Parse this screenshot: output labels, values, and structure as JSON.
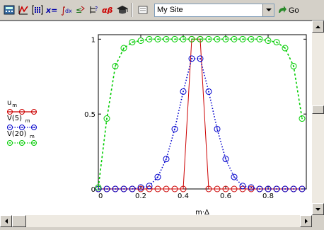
{
  "toolbar": {
    "address_value": "My Site",
    "go_label": "Go",
    "icons": [
      "calculator-icon",
      "graph-icon",
      "matrix-icon",
      "evaluation-icon",
      "calculus-icon",
      "boolean-icon",
      "programming-icon",
      "greek-icon",
      "symbolic-icon"
    ]
  },
  "legend": {
    "items": [
      {
        "label": "u",
        "sub": "m",
        "color": "#cc0000",
        "marker": "circle"
      },
      {
        "label": "V(5)",
        "sub": "m",
        "color": "#0000cc",
        "marker": "circle-dot"
      },
      {
        "label": "V(20)",
        "sub": "m",
        "color": "#00cc00",
        "marker": "circle-dot"
      }
    ]
  },
  "chart_data": {
    "type": "line",
    "xlabel": "m·Δ",
    "ylabel": "",
    "xlim": [
      0,
      0.98
    ],
    "ylim": [
      0,
      1.03
    ],
    "xticks": [
      0,
      0.2,
      0.4,
      0.6,
      0.8
    ],
    "xtick_labels": [
      "0",
      "0.2",
      "0.4",
      "0.6",
      "0.8"
    ],
    "yticks": [
      0,
      0.5,
      1
    ],
    "ytick_labels": [
      "0",
      "0.5",
      "1"
    ],
    "x": [
      0,
      0.04,
      0.08,
      0.12,
      0.16,
      0.2,
      0.24,
      0.28,
      0.32,
      0.36,
      0.4,
      0.44,
      0.48,
      0.52,
      0.56,
      0.6,
      0.64,
      0.68,
      0.72,
      0.76,
      0.8,
      0.84,
      0.88,
      0.92,
      0.96
    ],
    "series": [
      {
        "name": "u_m",
        "color": "#cc0000",
        "style": "solid",
        "values": [
          0,
          0,
          0,
          0,
          0,
          0,
          0,
          0,
          0,
          0,
          0,
          1,
          1,
          0,
          0,
          0,
          0,
          0,
          0,
          0,
          0,
          0,
          0,
          0,
          0
        ]
      },
      {
        "name": "V(5)_m",
        "color": "#0000cc",
        "style": "dotted",
        "values": [
          0,
          0,
          0,
          0,
          0,
          0.01,
          0.02,
          0.08,
          0.2,
          0.4,
          0.65,
          0.87,
          0.87,
          0.65,
          0.4,
          0.2,
          0.08,
          0.02,
          0.01,
          0,
          0,
          0,
          0,
          0,
          0
        ]
      },
      {
        "name": "V(20)_m",
        "color": "#00cc00",
        "style": "dashed",
        "values": [
          0.01,
          0.47,
          0.82,
          0.94,
          0.98,
          0.99,
          1,
          1,
          1,
          1,
          1,
          1,
          1,
          1,
          1,
          1,
          1,
          1,
          1,
          1,
          0.99,
          0.98,
          0.94,
          0.82,
          0.47
        ]
      }
    ]
  }
}
